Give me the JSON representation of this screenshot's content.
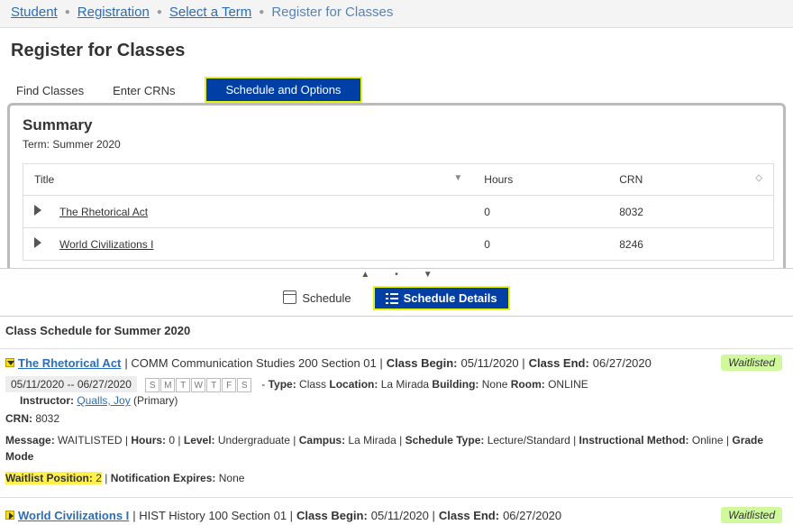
{
  "breadcrumb": {
    "student": "Student",
    "registration": "Registration",
    "select_term": "Select a Term",
    "current": "Register for Classes"
  },
  "page_title": "Register for Classes",
  "tabs": {
    "find": "Find Classes",
    "enter": "Enter CRNs",
    "sched_opt": "Schedule and Options"
  },
  "summary": {
    "title": "Summary",
    "term_label": "Term:  Summer 2020",
    "cols": {
      "title": "Title",
      "hours": "Hours",
      "crn": "CRN"
    },
    "rows": [
      {
        "title": "The Rhetorical Act",
        "hours": "0",
        "crn": "8032"
      },
      {
        "title": "World Civilizations I",
        "hours": "0",
        "crn": "8246"
      }
    ]
  },
  "subtabs": {
    "schedule": "Schedule",
    "details": "Schedule Details"
  },
  "schedule_header": "Class Schedule for Summer 2020",
  "class1": {
    "title": "The Rhetorical Act",
    "desc": " | COMM Communication Studies 200 Section 01 | ",
    "begin_label": "Class Begin:",
    "begin": " 05/11/2020 | ",
    "end_label": "Class End:",
    "end": " 06/27/2020",
    "badge": "Waitlisted",
    "dates": "05/11/2020 -- 06/27/2020",
    "days": [
      "S",
      "M",
      "T",
      "W",
      "T",
      "F",
      "S"
    ],
    "type_line1": "Type:",
    "type_line2": " Class ",
    "loc_label": "Location:",
    "loc": " La Mirada ",
    "bldg_label": "Building:",
    "bldg": " None ",
    "room_label": "Room:",
    "room": " ONLINE",
    "instructor_label": "Instructor: ",
    "instructor_link": "Qualls, Joy",
    "instructor_suffix": " (Primary)",
    "crn_label": "CRN: ",
    "crn": "8032",
    "msg_label": "Message:",
    "msg": " WAITLISTED | ",
    "hours_label": "Hours:",
    "hours": " 0 | ",
    "level_label": "Level:",
    "level": " Undergraduate | ",
    "campus_label": "Campus:",
    "campus": " La Mirada | ",
    "stype_label": "Schedule Type:",
    "stype": " Lecture/Standard | ",
    "imethod_label": "Instructional Method:",
    "imethod": " Online | ",
    "gmode_label": "Grade Mode",
    "wp_label": "Waitlist Position:",
    "wp": " 2",
    "wp_sep": " | ",
    "ne_label": "Notification Expires:",
    "ne": " None"
  },
  "class2": {
    "title": "World Civilizations I",
    "desc": " | HIST History 100 Section 01 | ",
    "begin_label": "Class Begin:",
    "begin": " 05/11/2020 | ",
    "end_label": "Class End:",
    "end": " 06/27/2020",
    "badge": "Waitlisted"
  }
}
